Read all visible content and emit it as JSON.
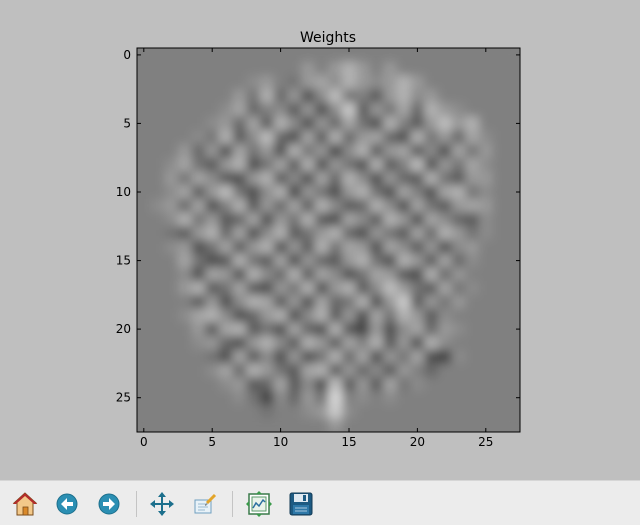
{
  "chart_data": {
    "type": "heatmap",
    "title": "Weights",
    "xlabel": "",
    "ylabel": "",
    "rows": 28,
    "cols": 28,
    "xlim": [
      -0.5,
      27.5
    ],
    "ylim": [
      27.5,
      -0.5
    ],
    "x_ticks": [
      0,
      5,
      10,
      15,
      20,
      25
    ],
    "y_ticks": [
      0,
      5,
      10,
      15,
      20,
      25
    ],
    "colormap": "gray",
    "interpolation": "bilinear",
    "background_value": 0.5,
    "values": [
      [
        0.5,
        0.5,
        0.5,
        0.5,
        0.5,
        0.5,
        0.5,
        0.5,
        0.5,
        0.5,
        0.5,
        0.5,
        0.5,
        0.5,
        0.5,
        0.5,
        0.5,
        0.5,
        0.5,
        0.5,
        0.5,
        0.5,
        0.5,
        0.5,
        0.5,
        0.5,
        0.5,
        0.5
      ],
      [
        0.5,
        0.5,
        0.5,
        0.5,
        0.5,
        0.5,
        0.5,
        0.5,
        0.5,
        0.5,
        0.5,
        0.5,
        0.6,
        0.5,
        0.6,
        0.7,
        0.6,
        0.5,
        0.6,
        0.5,
        0.5,
        0.5,
        0.5,
        0.5,
        0.5,
        0.5,
        0.5,
        0.5
      ],
      [
        0.5,
        0.5,
        0.5,
        0.5,
        0.5,
        0.5,
        0.5,
        0.5,
        0.55,
        0.6,
        0.5,
        0.45,
        0.6,
        0.65,
        0.55,
        0.7,
        0.6,
        0.55,
        0.6,
        0.7,
        0.6,
        0.5,
        0.5,
        0.5,
        0.5,
        0.5,
        0.5,
        0.5
      ],
      [
        0.5,
        0.5,
        0.5,
        0.5,
        0.5,
        0.5,
        0.5,
        0.6,
        0.45,
        0.7,
        0.4,
        0.6,
        0.3,
        0.55,
        0.75,
        0.45,
        0.5,
        0.35,
        0.6,
        0.7,
        0.55,
        0.6,
        0.5,
        0.5,
        0.5,
        0.5,
        0.5,
        0.5
      ],
      [
        0.5,
        0.5,
        0.5,
        0.5,
        0.5,
        0.5,
        0.55,
        0.65,
        0.4,
        0.5,
        0.55,
        0.35,
        0.6,
        0.3,
        0.55,
        0.8,
        0.35,
        0.6,
        0.45,
        0.65,
        0.4,
        0.7,
        0.6,
        0.55,
        0.5,
        0.5,
        0.5,
        0.5
      ],
      [
        0.5,
        0.5,
        0.5,
        0.5,
        0.5,
        0.55,
        0.6,
        0.4,
        0.65,
        0.35,
        0.7,
        0.55,
        0.3,
        0.6,
        0.4,
        0.65,
        0.45,
        0.3,
        0.7,
        0.5,
        0.35,
        0.6,
        0.75,
        0.6,
        0.7,
        0.5,
        0.5,
        0.5
      ],
      [
        0.5,
        0.5,
        0.5,
        0.5,
        0.55,
        0.45,
        0.7,
        0.35,
        0.55,
        0.75,
        0.4,
        0.3,
        0.65,
        0.35,
        0.7,
        0.4,
        0.6,
        0.65,
        0.4,
        0.3,
        0.7,
        0.45,
        0.6,
        0.4,
        0.65,
        0.55,
        0.5,
        0.5
      ],
      [
        0.5,
        0.5,
        0.5,
        0.6,
        0.4,
        0.6,
        0.3,
        0.65,
        0.45,
        0.6,
        0.3,
        0.7,
        0.45,
        0.6,
        0.25,
        0.55,
        0.7,
        0.35,
        0.6,
        0.65,
        0.35,
        0.55,
        0.3,
        0.65,
        0.45,
        0.6,
        0.5,
        0.5
      ],
      [
        0.5,
        0.5,
        0.55,
        0.65,
        0.45,
        0.35,
        0.6,
        0.7,
        0.3,
        0.45,
        0.65,
        0.35,
        0.7,
        0.3,
        0.6,
        0.45,
        0.3,
        0.7,
        0.35,
        0.5,
        0.75,
        0.3,
        0.6,
        0.45,
        0.65,
        0.55,
        0.5,
        0.5
      ],
      [
        0.5,
        0.5,
        0.6,
        0.45,
        0.65,
        0.55,
        0.35,
        0.3,
        0.6,
        0.7,
        0.35,
        0.55,
        0.3,
        0.65,
        0.4,
        0.7,
        0.55,
        0.3,
        0.6,
        0.4,
        0.35,
        0.7,
        0.45,
        0.35,
        0.6,
        0.6,
        0.5,
        0.5
      ],
      [
        0.5,
        0.5,
        0.55,
        0.65,
        0.35,
        0.6,
        0.75,
        0.45,
        0.3,
        0.55,
        0.7,
        0.25,
        0.6,
        0.45,
        0.3,
        0.6,
        0.7,
        0.45,
        0.3,
        0.65,
        0.5,
        0.3,
        0.65,
        0.7,
        0.45,
        0.55,
        0.5,
        0.5
      ],
      [
        0.5,
        0.55,
        0.6,
        0.4,
        0.65,
        0.3,
        0.5,
        0.7,
        0.35,
        0.6,
        0.4,
        0.65,
        0.35,
        0.7,
        0.55,
        0.35,
        0.4,
        0.7,
        0.55,
        0.3,
        0.65,
        0.45,
        0.35,
        0.6,
        0.65,
        0.6,
        0.5,
        0.5
      ],
      [
        0.5,
        0.5,
        0.55,
        0.7,
        0.45,
        0.6,
        0.35,
        0.4,
        0.65,
        0.3,
        0.6,
        0.45,
        0.7,
        0.35,
        0.3,
        0.65,
        0.55,
        0.35,
        0.7,
        0.6,
        0.3,
        0.65,
        0.55,
        0.4,
        0.35,
        0.55,
        0.5,
        0.5
      ],
      [
        0.5,
        0.5,
        0.45,
        0.35,
        0.6,
        0.7,
        0.4,
        0.65,
        0.3,
        0.55,
        0.7,
        0.35,
        0.45,
        0.6,
        0.7,
        0.4,
        0.3,
        0.6,
        0.45,
        0.35,
        0.65,
        0.4,
        0.7,
        0.6,
        0.45,
        0.55,
        0.5,
        0.5
      ],
      [
        0.5,
        0.5,
        0.55,
        0.6,
        0.3,
        0.45,
        0.65,
        0.35,
        0.6,
        0.7,
        0.3,
        0.6,
        0.35,
        0.7,
        0.45,
        0.65,
        0.6,
        0.3,
        0.65,
        0.55,
        0.35,
        0.6,
        0.3,
        0.55,
        0.6,
        0.5,
        0.5,
        0.5
      ],
      [
        0.5,
        0.5,
        0.5,
        0.65,
        0.45,
        0.3,
        0.35,
        0.7,
        0.45,
        0.35,
        0.65,
        0.3,
        0.6,
        0.4,
        0.35,
        0.6,
        0.7,
        0.45,
        0.3,
        0.7,
        0.6,
        0.35,
        0.65,
        0.4,
        0.55,
        0.5,
        0.5,
        0.5
      ],
      [
        0.5,
        0.5,
        0.5,
        0.55,
        0.3,
        0.65,
        0.6,
        0.3,
        0.7,
        0.55,
        0.4,
        0.7,
        0.35,
        0.65,
        0.55,
        0.3,
        0.45,
        0.65,
        0.6,
        0.35,
        0.3,
        0.7,
        0.4,
        0.6,
        0.5,
        0.5,
        0.5,
        0.5
      ],
      [
        0.5,
        0.5,
        0.5,
        0.6,
        0.7,
        0.35,
        0.45,
        0.65,
        0.35,
        0.3,
        0.6,
        0.45,
        0.7,
        0.3,
        0.6,
        0.7,
        0.35,
        0.55,
        0.75,
        0.6,
        0.45,
        0.35,
        0.65,
        0.45,
        0.55,
        0.5,
        0.5,
        0.5
      ],
      [
        0.5,
        0.5,
        0.5,
        0.5,
        0.35,
        0.6,
        0.3,
        0.55,
        0.7,
        0.65,
        0.35,
        0.6,
        0.3,
        0.65,
        0.4,
        0.45,
        0.7,
        0.3,
        0.6,
        0.8,
        0.35,
        0.6,
        0.45,
        0.6,
        0.5,
        0.5,
        0.5,
        0.5
      ],
      [
        0.5,
        0.5,
        0.5,
        0.55,
        0.65,
        0.7,
        0.55,
        0.3,
        0.4,
        0.6,
        0.7,
        0.3,
        0.55,
        0.7,
        0.35,
        0.6,
        0.3,
        0.65,
        0.45,
        0.7,
        0.6,
        0.35,
        0.55,
        0.5,
        0.5,
        0.5,
        0.5,
        0.5
      ],
      [
        0.5,
        0.5,
        0.5,
        0.5,
        0.6,
        0.35,
        0.65,
        0.7,
        0.35,
        0.45,
        0.3,
        0.65,
        0.4,
        0.3,
        0.7,
        0.35,
        0.25,
        0.6,
        0.3,
        0.55,
        0.65,
        0.4,
        0.6,
        0.55,
        0.5,
        0.5,
        0.5,
        0.5
      ],
      [
        0.5,
        0.5,
        0.5,
        0.5,
        0.55,
        0.6,
        0.4,
        0.3,
        0.6,
        0.7,
        0.55,
        0.35,
        0.7,
        0.6,
        0.35,
        0.65,
        0.5,
        0.7,
        0.35,
        0.6,
        0.3,
        0.7,
        0.55,
        0.5,
        0.5,
        0.5,
        0.5,
        0.5
      ],
      [
        0.5,
        0.5,
        0.5,
        0.5,
        0.5,
        0.45,
        0.3,
        0.65,
        0.35,
        0.55,
        0.3,
        0.6,
        0.3,
        0.45,
        0.7,
        0.4,
        0.65,
        0.3,
        0.6,
        0.45,
        0.65,
        0.3,
        0.25,
        0.55,
        0.5,
        0.5,
        0.5,
        0.5
      ],
      [
        0.5,
        0.5,
        0.5,
        0.5,
        0.5,
        0.55,
        0.65,
        0.4,
        0.7,
        0.6,
        0.45,
        0.35,
        0.65,
        0.7,
        0.35,
        0.6,
        0.4,
        0.55,
        0.35,
        0.6,
        0.5,
        0.4,
        0.5,
        0.5,
        0.5,
        0.5,
        0.5,
        0.5
      ],
      [
        0.5,
        0.5,
        0.5,
        0.5,
        0.5,
        0.5,
        0.55,
        0.6,
        0.35,
        0.4,
        0.65,
        0.35,
        0.55,
        0.3,
        0.75,
        0.35,
        0.6,
        0.35,
        0.65,
        0.45,
        0.55,
        0.5,
        0.5,
        0.5,
        0.5,
        0.5,
        0.5,
        0.5
      ],
      [
        0.5,
        0.5,
        0.5,
        0.5,
        0.5,
        0.5,
        0.5,
        0.55,
        0.45,
        0.25,
        0.55,
        0.4,
        0.6,
        0.45,
        0.85,
        0.5,
        0.55,
        0.5,
        0.55,
        0.5,
        0.5,
        0.5,
        0.5,
        0.5,
        0.5,
        0.5,
        0.5,
        0.5
      ],
      [
        0.5,
        0.5,
        0.5,
        0.5,
        0.5,
        0.5,
        0.5,
        0.5,
        0.5,
        0.45,
        0.5,
        0.5,
        0.55,
        0.6,
        0.8,
        0.55,
        0.5,
        0.5,
        0.5,
        0.5,
        0.5,
        0.5,
        0.5,
        0.5,
        0.5,
        0.5,
        0.5,
        0.5
      ],
      [
        0.5,
        0.5,
        0.5,
        0.5,
        0.5,
        0.5,
        0.5,
        0.5,
        0.5,
        0.5,
        0.5,
        0.5,
        0.5,
        0.5,
        0.6,
        0.5,
        0.5,
        0.5,
        0.5,
        0.5,
        0.5,
        0.5,
        0.5,
        0.5,
        0.5,
        0.5,
        0.5,
        0.5
      ]
    ]
  },
  "toolbar": {
    "buttons": [
      {
        "name": "home",
        "icon": "home-icon"
      },
      {
        "name": "back",
        "icon": "arrow-left-icon"
      },
      {
        "name": "forward",
        "icon": "arrow-right-icon"
      },
      {
        "name": "pan",
        "icon": "move-icon"
      },
      {
        "name": "zoom",
        "icon": "zoom-rect-icon"
      },
      {
        "name": "subplots",
        "icon": "configure-subplots-icon"
      },
      {
        "name": "save",
        "icon": "save-icon"
      }
    ],
    "colors": {
      "background": "#ececec",
      "accent": "#2b8fb3",
      "home_roof": "#b42b2b"
    }
  }
}
